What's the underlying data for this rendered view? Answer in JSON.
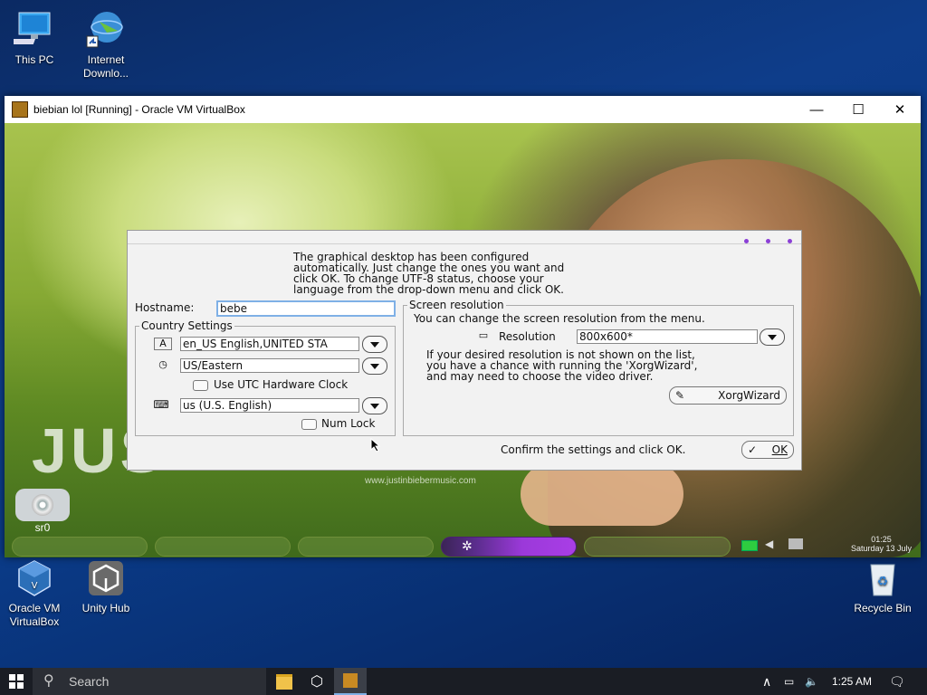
{
  "desktop": {
    "icons_top": [
      {
        "label_lines": [
          "This PC"
        ]
      },
      {
        "label_lines": [
          "Internet",
          "Downlo..."
        ]
      }
    ],
    "icons_bottom": [
      {
        "label_lines": [
          "Oracle VM",
          "VirtualBox"
        ]
      },
      {
        "label_lines": [
          "Unity Hub"
        ]
      },
      {
        "label_lines": [
          "Recycle Bin"
        ]
      }
    ]
  },
  "vbox": {
    "title": "biebian lol [Running] - Oracle VM VirtualBox",
    "minimize_glyph": "—",
    "maximize_glyph": "☐",
    "close_glyph": "✕"
  },
  "guest": {
    "banner_text": "JUS",
    "web_url": "www.justinbiebermusic.com",
    "drive_label": "sr0",
    "clock_time": "01:25",
    "clock_date": "Saturday 13 July"
  },
  "dialog": {
    "intro_lines": [
      "The graphical desktop has been configured",
      "automatically. Just change the ones you want and",
      "click OK. To change UTF-8 status, choose your",
      "language from the drop-down menu and click OK."
    ],
    "hostname_label": "Hostname:",
    "hostname_value": "bebe",
    "country_settings_title": "Country Settings",
    "locale_value": "en_US English,UNITED STA",
    "timezone_value": "US/Eastern",
    "utc_label": "Use UTC Hardware Clock",
    "keyboard_value": "us (U.S. English)",
    "numlock_label": "Num Lock",
    "screen_title": "Screen resolution",
    "screen_desc": "You can change the screen resolution from the menu.",
    "resolution_label": "Resolution",
    "resolution_value": "800x600*",
    "xorg_lines": [
      "If your desired resolution is not shown on the list,",
      "you have a chance with running the 'XorgWizard',",
      "and may need to choose the video driver."
    ],
    "xorg_button": "XorgWizard",
    "confirm_text": "Confirm the settings and click OK.",
    "ok_button": "OK"
  },
  "taskbar": {
    "search_placeholder": "Search",
    "time": "1:25 AM"
  }
}
